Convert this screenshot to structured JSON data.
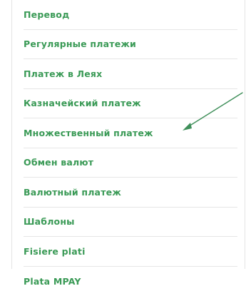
{
  "theme": {
    "link_color": "#3a9a56",
    "arrow_color": "#3f8f5a",
    "divider_color": "#e6e6e6"
  },
  "menu": {
    "items": [
      {
        "label": "Перевод"
      },
      {
        "label": "Регулярные платежи"
      },
      {
        "label": "Платеж в Леях"
      },
      {
        "label": "Казначейский платеж"
      },
      {
        "label": "Множественный платеж"
      },
      {
        "label": "Обмен валют"
      },
      {
        "label": "Валютный платеж"
      },
      {
        "label": "Шаблоны"
      },
      {
        "label": "Fisiere plati"
      },
      {
        "label": "Plata MPAY"
      }
    ]
  },
  "annotation": {
    "icon": "arrow-pointer-icon"
  }
}
